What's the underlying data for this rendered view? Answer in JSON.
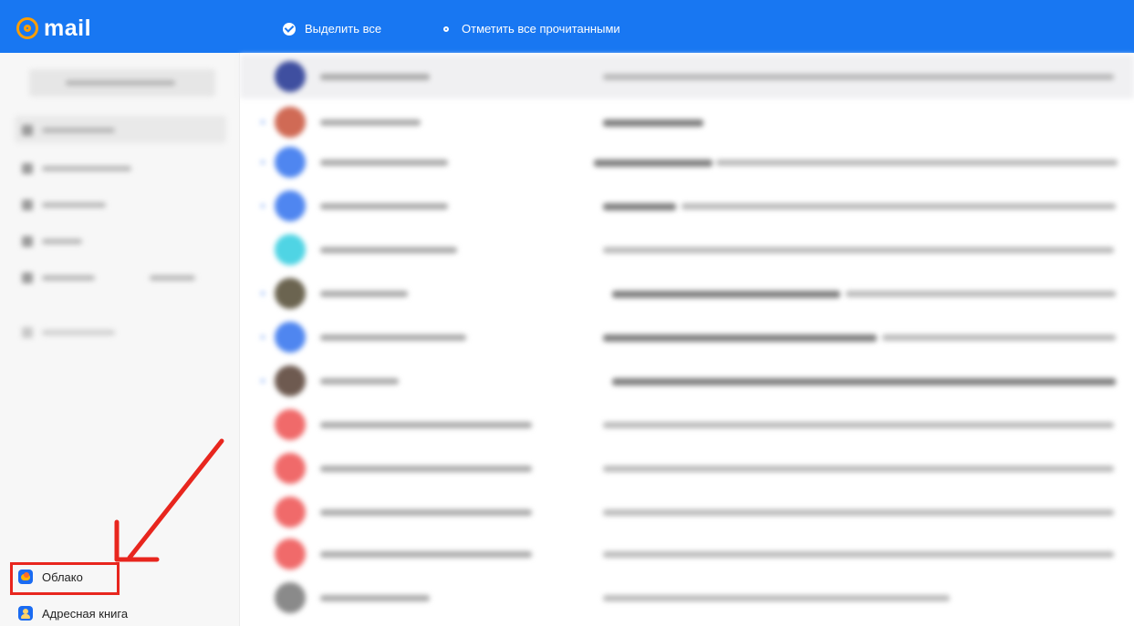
{
  "topbar": {
    "logo_text": "mail",
    "select_all_label": "Выделить все",
    "mark_all_read_label": "Отметить все прочитанными",
    "accent_color": "#1877f2"
  },
  "sidebar": {
    "bottom_items": [
      {
        "label": "Облако",
        "icon": "cloud-icon",
        "highlighted": true
      },
      {
        "label": "Адресная книга",
        "icon": "address-book-icon"
      }
    ]
  },
  "annotation": {
    "arrow_color": "#e8261e",
    "points_to": "Облако"
  }
}
